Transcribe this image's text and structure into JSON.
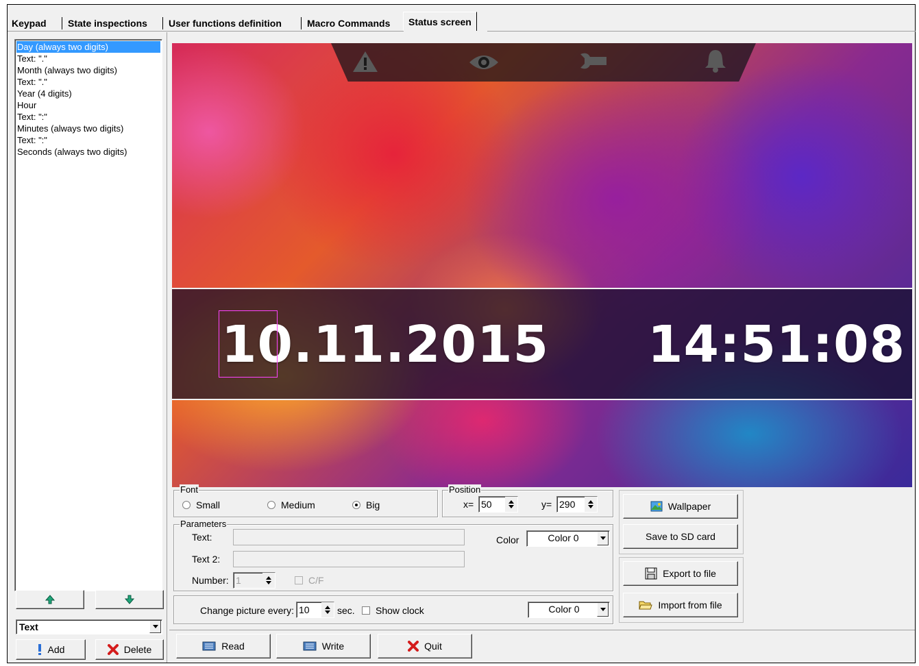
{
  "tabs": [
    {
      "label": "Keypad"
    },
    {
      "label": "State inspections"
    },
    {
      "label": "User functions definition"
    },
    {
      "label": "Macro Commands"
    },
    {
      "label": "Status screen"
    }
  ],
  "active_tab": "Status screen",
  "element_list": {
    "items": [
      "Day (always two digits)",
      "Text: \".\"",
      "Month (always two digits)",
      "Text: \".\"",
      "Year (4 digits)",
      "Hour",
      "Text: \":\"",
      "Minutes (always two digits)",
      "Text: \":\"",
      "Seconds (always two digits)"
    ],
    "selected_index": 0
  },
  "element_type": {
    "value": "Text"
  },
  "list_buttons": {
    "add": "Add",
    "delete": "Delete"
  },
  "preview": {
    "date": "10.11.2015",
    "time": "14:51:08",
    "status_icons": [
      "warning-icon",
      "eye-icon",
      "wrench-icon",
      "bell-icon"
    ]
  },
  "font": {
    "legend": "Font",
    "options": [
      "Small",
      "Medium",
      "Big"
    ],
    "selected": "Big"
  },
  "position": {
    "legend": "Position",
    "x_label": "x=",
    "x": "50",
    "y_label": "y=",
    "y": "290"
  },
  "parameters": {
    "legend": "Parameters",
    "text_label": "Text:",
    "text2_label": "Text 2:",
    "number_label": "Number:",
    "number": "1",
    "cf_label": "C/F",
    "color_label": "Color",
    "color_value": "Color 0"
  },
  "change_picture": {
    "label": "Change picture every:",
    "value": "10",
    "unit": "sec.",
    "show_clock_label": "Show clock",
    "color_value": "Color 0"
  },
  "side_buttons": {
    "wallpaper": "Wallpaper",
    "save_sd": "Save to SD card",
    "export": "Export to file",
    "import": "Import from file"
  },
  "bottom_buttons": {
    "read": "Read",
    "write": "Write",
    "quit": "Quit"
  },
  "colors": {
    "selection": "#3399ff",
    "element_outline": "#ff44ff"
  }
}
